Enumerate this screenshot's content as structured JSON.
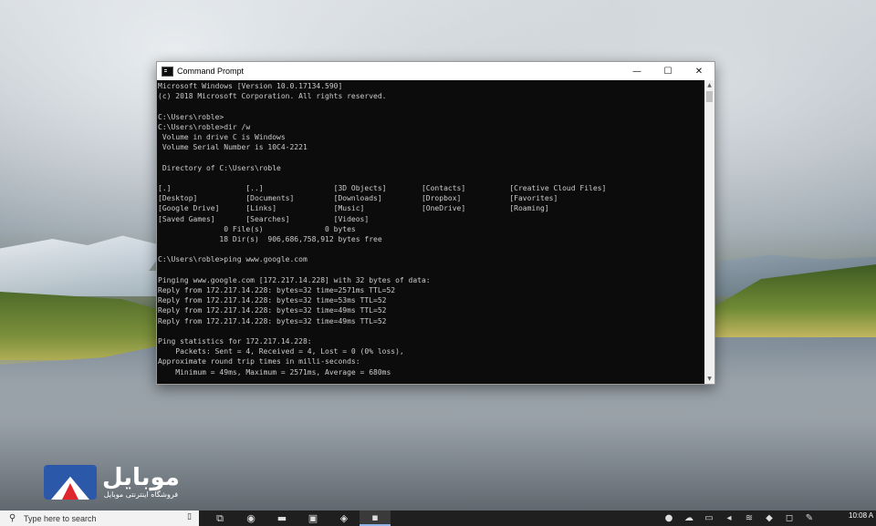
{
  "window": {
    "title": "Command Prompt",
    "controls": {
      "minimize": "—",
      "maximize": "☐",
      "close": "✕"
    }
  },
  "console": {
    "lines": [
      "Microsoft Windows [Version 10.0.17134.590]",
      "(c) 2018 Microsoft Corporation. All rights reserved.",
      "",
      "C:\\Users\\roble>",
      "C:\\Users\\roble>dir /w",
      " Volume in drive C is Windows",
      " Volume Serial Number is 10C4-2221",
      "",
      " Directory of C:\\Users\\roble",
      "",
      "[.]                 [..]                [3D Objects]        [Contacts]          [Creative Cloud Files]",
      "[Desktop]           [Documents]         [Downloads]         [Dropbox]           [Favorites]",
      "[Google Drive]      [Links]             [Music]             [OneDrive]          [Roaming]",
      "[Saved Games]       [Searches]          [Videos]",
      "               0 File(s)              0 bytes",
      "              18 Dir(s)  906,686,758,912 bytes free",
      "",
      "C:\\Users\\roble>ping www.google.com",
      "",
      "Pinging www.google.com [172.217.14.228] with 32 bytes of data:",
      "Reply from 172.217.14.228: bytes=32 time=2571ms TTL=52",
      "Reply from 172.217.14.228: bytes=32 time=53ms TTL=52",
      "Reply from 172.217.14.228: bytes=32 time=49ms TTL=52",
      "Reply from 172.217.14.228: bytes=32 time=49ms TTL=52",
      "",
      "Ping statistics for 172.217.14.228:",
      "    Packets: Sent = 4, Received = 4, Lost = 0 (0% loss),",
      "Approximate round trip times in milli-seconds:",
      "    Minimum = 49ms, Maximum = 2571ms, Average = 680ms"
    ]
  },
  "watermark": {
    "name": "موبایل",
    "subtitle": "فروشگاه اینترنتی موبایل"
  },
  "taskbar": {
    "search_placeholder": "Type here to search",
    "clock": "10:08 A"
  },
  "colors": {
    "console_bg": "#0c0c0c",
    "console_text": "#cccccc",
    "brand_blue": "#2b58a8",
    "brand_red": "#e0262d"
  }
}
